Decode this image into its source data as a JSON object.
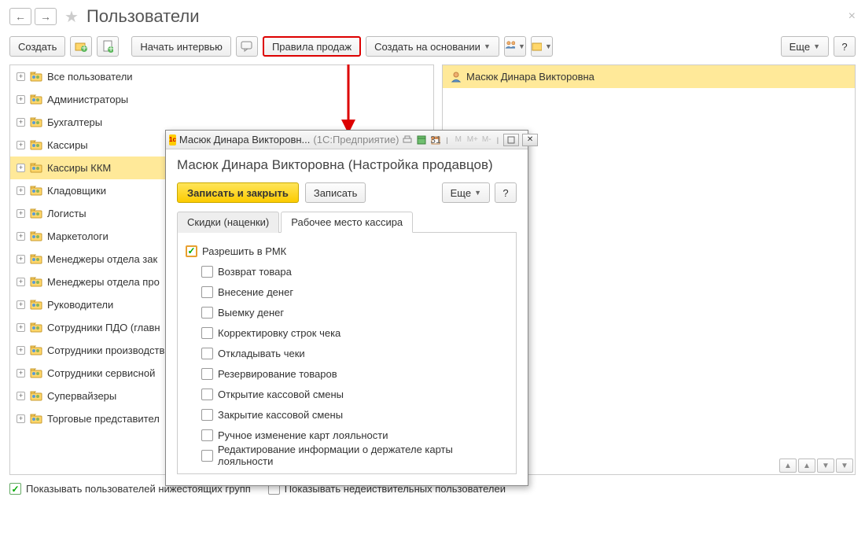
{
  "page": {
    "title": "Пользователи"
  },
  "toolbar": {
    "create": "Создать",
    "interview": "Начать интервью",
    "sales_rules": "Правила продаж",
    "create_based": "Создать на основании",
    "more": "Еще"
  },
  "tree": {
    "items": [
      "Все пользователи",
      "Администраторы",
      "Бухгалтеры",
      "Кассиры",
      "Кассиры ККМ",
      "Кладовщики",
      "Логисты",
      "Маркетологи",
      "Менеджеры отдела зак",
      "Менеджеры отдела про",
      "Руководители",
      "Сотрудники ПДО (главн",
      "Сотрудники производств",
      "Сотрудники сервисной",
      "Супервайзеры",
      "Торговые представител"
    ]
  },
  "selected_user": "Масюк Динара Викторовна",
  "dialog": {
    "title_name": "Масюк Динара Викторовн...",
    "title_app": "(1С:Предприятие)",
    "heading": "Масюк Динара Викторовна (Настройка продавцов)",
    "save_close": "Записать и закрыть",
    "save": "Записать",
    "more": "Еще",
    "help": "?",
    "tab1": "Скидки (наценки)",
    "tab2": "Рабочее место кассира",
    "allow_rmk": "Разрешить в РМК",
    "opts": [
      "Возврат товара",
      "Внесение денег",
      "Выемку денег",
      "Корректировку строк чека",
      "Откладывать чеки",
      "Резервирование товаров",
      "Открытие кассовой смены",
      "Закрытие кассовой смены",
      "Ручное изменение карт лояльности",
      "Редактирование информации о держателе карты лояльности"
    ],
    "win_m": "M",
    "win_mplus": "M+",
    "win_mminus": "M-"
  },
  "footer": {
    "show_sub": "Показывать пользователей нижестоящих групп",
    "show_invalid": "Показывать недействительных пользователей"
  }
}
